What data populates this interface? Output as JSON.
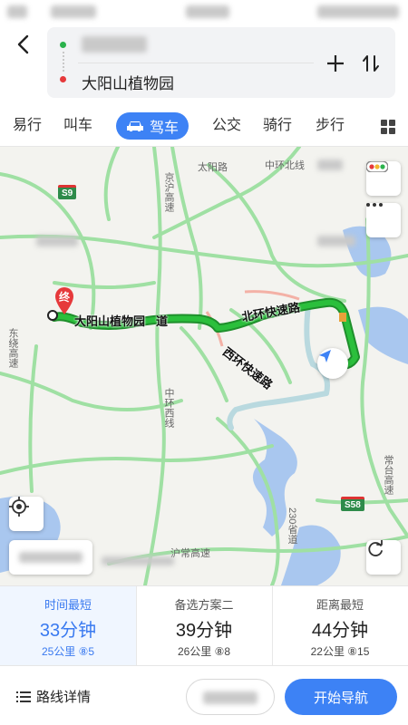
{
  "route": {
    "destination": "大阳山植物园"
  },
  "tabs": [
    {
      "label": "易行"
    },
    {
      "label": "叫车"
    },
    {
      "label": "驾车"
    },
    {
      "label": "公交"
    },
    {
      "label": "骑行"
    },
    {
      "label": "步行"
    }
  ],
  "map": {
    "road_labels": {
      "taiyang_road": "太阳路",
      "zhonghuan_north": "中环北线",
      "jingcheng_expressway": "京沪高速",
      "dongbian_expressway": "东绕高速",
      "zhonghuan_west": "中环西线",
      "huchang_expressway": "沪常高速",
      "east_highway": "常台高速",
      "pass_road": "230省道"
    },
    "shields": {
      "s9": "S9",
      "s58": "S58"
    },
    "route_labels": {
      "dest_name": "大阳山植物园",
      "dao": "道",
      "north_ring": "北环快速路",
      "west_ring": "西环快速路"
    },
    "marker_label": "终"
  },
  "plans": [
    {
      "title": "时间最短",
      "time": "33分钟",
      "sub": "25公里  ⑧5"
    },
    {
      "title": "备选方案二",
      "time": "39分钟",
      "sub": "26公里  ⑧8"
    },
    {
      "title": "距离最短",
      "time": "44分钟",
      "sub": "22公里  ⑧15"
    }
  ],
  "bottom": {
    "details_label": "路线详情",
    "go_label": "开始导航"
  },
  "colors": {
    "accent": "#3d82f5",
    "route": "#2bbf3c",
    "start_dot": "#2bb24c",
    "end_dot": "#e6393b"
  }
}
